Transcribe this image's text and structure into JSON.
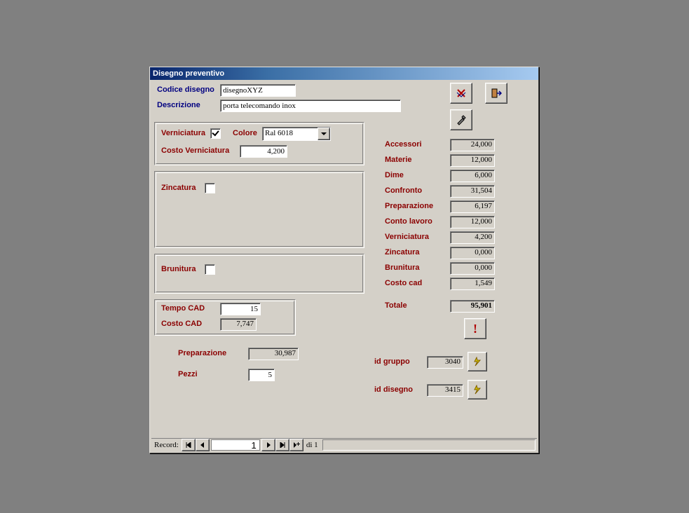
{
  "window": {
    "title": "Disegno preventivo"
  },
  "header": {
    "codice_label": "Codice disegno",
    "codice_value": "disegnoXYZ",
    "descr_label": "Descrizione",
    "descr_value": "porta telecomando inox"
  },
  "vern": {
    "label": "Verniciatura",
    "colore_label": "Colore",
    "colore_value": "Ral 6018",
    "costo_label": "Costo Verniciatura",
    "costo_value": "4,200"
  },
  "zinc": {
    "label": "Zincatura"
  },
  "brun": {
    "label": "Brunitura"
  },
  "cad": {
    "tempo_label": "Tempo CAD",
    "tempo_value": "15",
    "costo_label": "Costo CAD",
    "costo_value": "7,747"
  },
  "bottom": {
    "prep_label": "Preparazione",
    "prep_value": "30,987",
    "pezzi_label": "Pezzi",
    "pezzi_value": "5"
  },
  "costs": {
    "accessori_l": "Accessori",
    "accessori_v": "24,000",
    "materie_l": "Materie",
    "materie_v": "12,000",
    "dime_l": "Dime",
    "dime_v": "6,000",
    "confronto_l": "Confronto",
    "confronto_v": "31,504",
    "prep_l": "Preparazione",
    "prep_v": "6,197",
    "conto_l": "Conto lavoro",
    "conto_v": "12,000",
    "vern_l": "Verniciatura",
    "vern_v": "4,200",
    "zinc_l": "Zincatura",
    "zinc_v": "0,000",
    "brun_l": "Brunitura",
    "brun_v": "0,000",
    "cad_l": "Costo cad",
    "cad_v": "1,549",
    "tot_l": "Totale",
    "tot_v": "95,901"
  },
  "ids": {
    "gruppo_l": "id gruppo",
    "gruppo_v": "3040",
    "disegno_l": "id disegno",
    "disegno_v": "3415"
  },
  "nav": {
    "record_label": "Record:",
    "current": "1",
    "of_label": "di 1"
  },
  "icons": {
    "delete": "delete-icon",
    "exit": "exit-icon",
    "tools": "tools-icon",
    "warn": "warning-icon",
    "flash": "flash-icon"
  }
}
